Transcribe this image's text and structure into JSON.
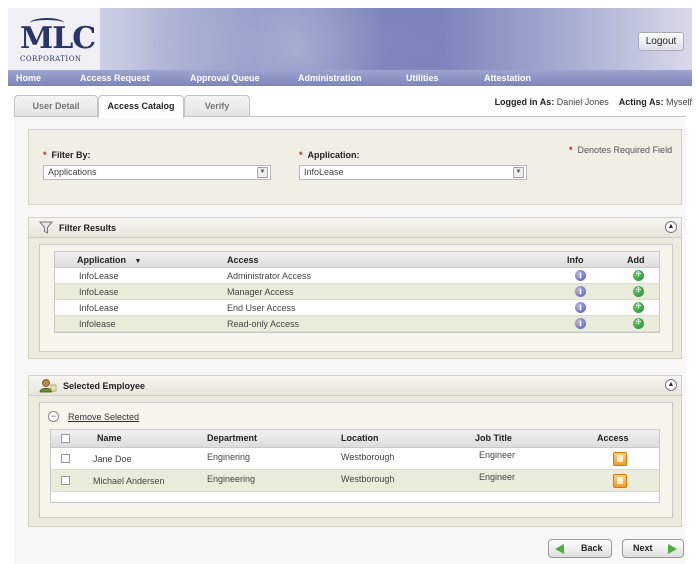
{
  "header": {
    "logo_text": "MLC",
    "logo_sub": "CORPORATION",
    "logout_label": "Logout"
  },
  "nav": {
    "items": [
      "Home",
      "Access Request",
      "Approval Queue",
      "Administration",
      "Utilities",
      "Attestation"
    ]
  },
  "tabs": [
    "User Detail",
    "Access Catalog",
    "Verify"
  ],
  "active_tab": "Access Catalog",
  "session": {
    "logged_in_label": "Logged in As:",
    "logged_in_user": "Daniel Jones",
    "acting_as_label": "Acting As:",
    "acting_as_user": "Myself"
  },
  "filter": {
    "filter_by_label": "Filter By:",
    "filter_by_value": "Applications",
    "application_label": "Application:",
    "application_value": "InfoLease",
    "required_note": "Denotes Required Field"
  },
  "filter_results": {
    "title": "Filter Results",
    "headers": {
      "application": "Application",
      "access": "Access",
      "info": "Info",
      "add": "Add"
    },
    "rows": [
      {
        "application": "InfoLease",
        "access": "Administrator Access"
      },
      {
        "application": "InfoLease",
        "access": "Manager Access"
      },
      {
        "application": "InfoLease",
        "access": "End User Access"
      },
      {
        "application": "Infolease",
        "access": "Read-only Access"
      }
    ]
  },
  "selected_employee": {
    "title": "Selected Employee",
    "remove_label": "Remove Selected",
    "headers": {
      "name": "Name",
      "department": "Department",
      "location": "Location",
      "job_title": "Job Title",
      "access": "Access"
    },
    "rows": [
      {
        "name": "Jane Doe",
        "department": "Enginering",
        "location": "Westborough",
        "job_title": "Engineer"
      },
      {
        "name": "Michael Andersen",
        "department": "Engineering",
        "location": "Westborough",
        "job_title": "Engineer"
      }
    ]
  },
  "buttons": {
    "back": "Back",
    "next": "Next"
  },
  "colors": {
    "nav_bar": "#8b91c4",
    "panel_bg": "#ececde",
    "row_alt": "#e9ecda",
    "required_star": "#c02020",
    "add_green": "#1e7d2b",
    "info_blue": "#4c55a5"
  }
}
